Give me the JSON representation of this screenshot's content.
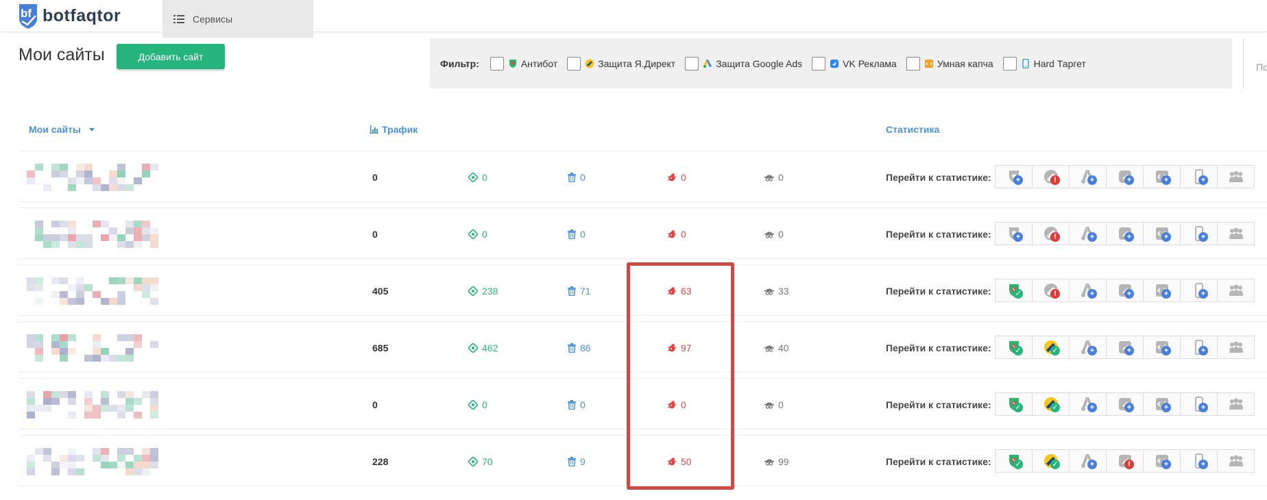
{
  "header": {
    "logo_text": "botfaqtor",
    "services_label": "Сервисы"
  },
  "page": {
    "title": "Мои сайты",
    "add_button": "Добавить сайт"
  },
  "filter": {
    "label": "Фильтр:",
    "items": [
      {
        "label": "Антибот",
        "icon": "antibot-shield-icon",
        "color": "#2fb36a"
      },
      {
        "label": "Защита Я.Директ",
        "icon": "yandex-direct-icon",
        "color": "#f5c518"
      },
      {
        "label": "Защита Google Ads",
        "icon": "google-ads-icon",
        "color": "#4285f4"
      },
      {
        "label": "VK Реклама",
        "icon": "vk-icon",
        "color": "#2787f5"
      },
      {
        "label": "Умная капча",
        "icon": "captcha-code-icon",
        "color": "#f0a020"
      },
      {
        "label": "Hard Таргет",
        "icon": "phone-icon",
        "color": "#3aa0c8"
      }
    ],
    "search_fragment": "По"
  },
  "table": {
    "headers": {
      "sites": "Мои сайты",
      "traffic": "Трафик",
      "stats": "Статистика"
    },
    "stat_label": "Перейти к статистике:",
    "rows": [
      {
        "traffic": "0",
        "green": "0",
        "blue": "0",
        "red": "0",
        "gray": "0",
        "badges": [
          "plus-gray",
          "warn-gray",
          "plus",
          "plus",
          "plus",
          "plus",
          "none"
        ]
      },
      {
        "traffic": "0",
        "green": "0",
        "blue": "0",
        "red": "0",
        "gray": "0",
        "badges": [
          "plus-gray",
          "warn-gray",
          "plus",
          "plus",
          "plus",
          "plus",
          "none"
        ]
      },
      {
        "traffic": "405",
        "green": "238",
        "blue": "71",
        "red": "63",
        "gray": "33",
        "badges": [
          "ok",
          "warn-gray",
          "plus",
          "plus",
          "plus",
          "plus",
          "none"
        ]
      },
      {
        "traffic": "685",
        "green": "462",
        "blue": "86",
        "red": "97",
        "gray": "40",
        "badges": [
          "ok",
          "ok-y",
          "plus",
          "plus",
          "plus",
          "plus",
          "none"
        ]
      },
      {
        "traffic": "0",
        "green": "0",
        "blue": "0",
        "red": "0",
        "gray": "0",
        "badges": [
          "ok",
          "ok-y",
          "plus",
          "plus",
          "plus",
          "plus",
          "none"
        ]
      },
      {
        "traffic": "228",
        "green": "70",
        "blue": "9",
        "red": "50",
        "gray": "99",
        "badges": [
          "ok",
          "ok-y",
          "plus",
          "warn",
          "plus",
          "plus",
          "none"
        ]
      }
    ]
  },
  "colors": {
    "accent": "#26b47e",
    "link": "#4a90d9",
    "danger": "#e04848",
    "highlight": "#cf4a44"
  }
}
